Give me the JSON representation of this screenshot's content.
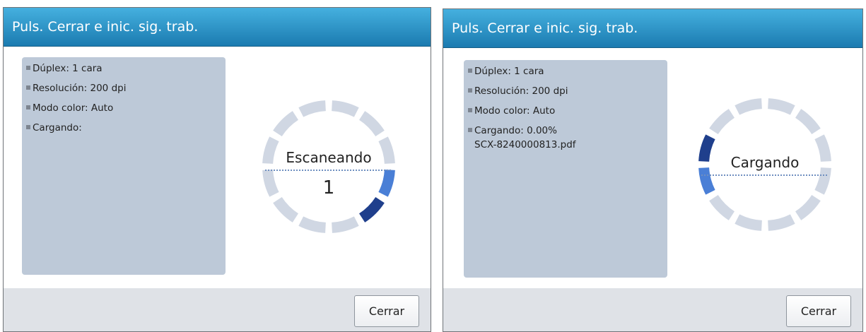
{
  "colors": {
    "title_bar": "#2b93c8",
    "info_box": "#bdc9d8",
    "segment_idle": "#d0d7e3",
    "segment_active_dark": "#1f3f8c",
    "segment_active_light": "#4a7fd6",
    "bottom_bar": "#dfe2e7"
  },
  "panels": [
    {
      "title": "Puls. Cerrar e inic. sig. trab.",
      "info": {
        "duplex": "Dúplex: 1 cara",
        "resolution": "Resolución: 200 dpi",
        "color_mode": "Modo color: Auto",
        "loading": "Cargando:",
        "file": ""
      },
      "status": {
        "label": "Escaneando",
        "count": "1",
        "active_segments": [
          3,
          4
        ],
        "dark_segment": 4
      },
      "close_label": "Cerrar"
    },
    {
      "title": "Puls. Cerrar e inic. sig. trab.",
      "info": {
        "duplex": "Dúplex: 1 cara",
        "resolution": "Resolución: 200 dpi",
        "color_mode": "Modo color: Auto",
        "loading": "Cargando: 0.00%",
        "file": "SCX-8240000813.pdf"
      },
      "status": {
        "label": "Cargando",
        "count": "",
        "active_segments": [
          8,
          9
        ],
        "dark_segment": 9
      },
      "close_label": "Cerrar"
    }
  ]
}
